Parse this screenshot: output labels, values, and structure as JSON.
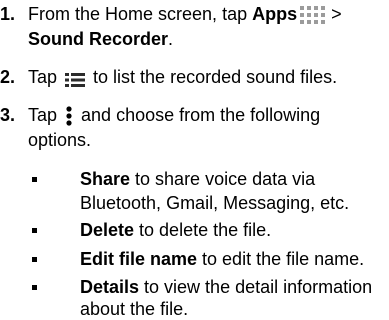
{
  "steps": [
    {
      "num": "1.",
      "lines": [
        {
          "t1": "From the Home screen, tap ",
          "b1": "Apps",
          "t2": " >"
        },
        {
          "b1": "Sound Recorder",
          "t2": "."
        }
      ]
    },
    {
      "num": "2.",
      "t1": "Tap ",
      "t2": " to list the recorded sound files."
    },
    {
      "num": "3.",
      "t1": "Tap ",
      "t2": " and choose from the following",
      "t3": "options."
    }
  ],
  "options": [
    {
      "bold": "Share",
      "l1": " to share voice data via",
      "l2": "Bluetooth, Gmail, Messaging, etc."
    },
    {
      "bold": "Delete",
      "l1": " to delete the file."
    },
    {
      "bold": "Edit file name",
      "l1": " to edit the file name."
    },
    {
      "bold": "Details",
      "l1": " to view the detail information",
      "l2": "about the file."
    }
  ],
  "icons": {
    "apps": "apps-grid-icon",
    "list": "list-icon",
    "more": "more-options-icon"
  },
  "colors": {
    "text": "#000000",
    "background": "#ffffff"
  }
}
